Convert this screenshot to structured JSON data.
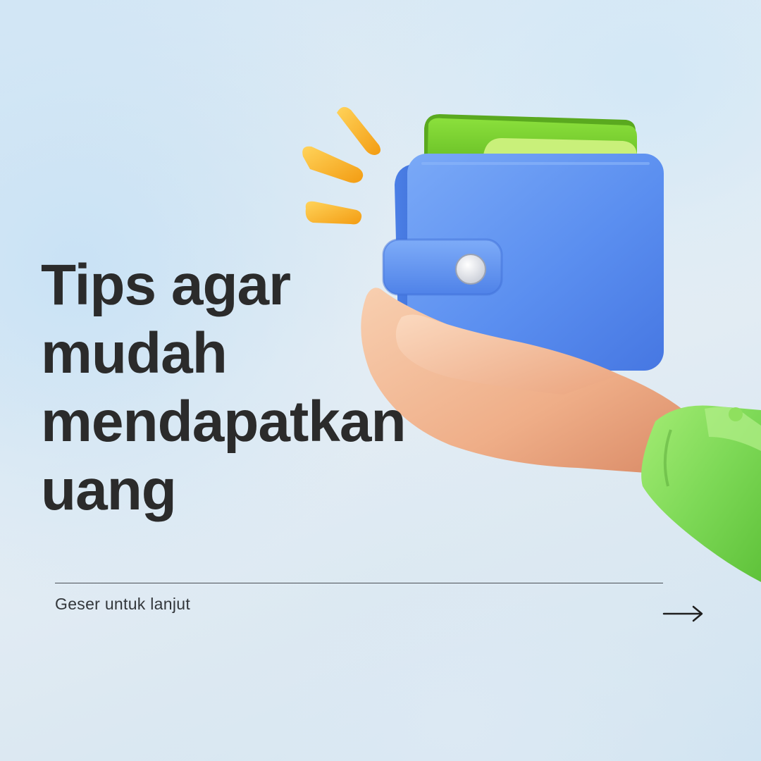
{
  "headline": {
    "line1": "Tips agar",
    "line2": "mudah",
    "line3": "mendapatkan",
    "line4": "uang"
  },
  "footer": {
    "swipe_text": "Geser untuk lanjut"
  },
  "icons": {
    "next": "arrow-right-icon",
    "illustration": "hand-holding-wallet-icon",
    "sparkle": "sparkle-burst-icon"
  },
  "colors": {
    "headline": "#2b2b2b",
    "wallet": "#5b8ff0",
    "money": "#7fd12f",
    "sleeve": "#7ed957",
    "sparkle": "#f7b31b",
    "skin": "#f1b48f"
  }
}
